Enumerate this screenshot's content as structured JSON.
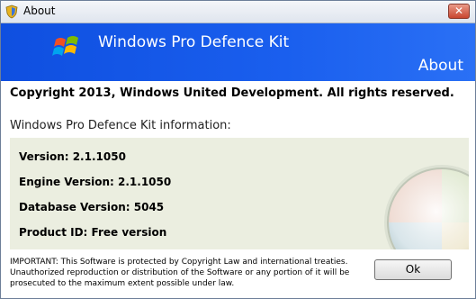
{
  "window": {
    "title": "About"
  },
  "banner": {
    "product_name": "Windows Pro Defence Kit",
    "section_label": "About"
  },
  "copyright": "Copyright 2013, Windows United Development. All rights reserved.",
  "info": {
    "heading": "Windows Pro Defence Kit information:",
    "version": "Version: 2.1.1050",
    "engine_version": "Engine Version: 2.1.1050",
    "database_version": "Database Version: 5045",
    "product_id": "Product ID: Free version"
  },
  "notice": {
    "line1": "IMPORTANT: This Software is protected by Copyright Law and international treaties.",
    "line2": "Unauthorized reproduction or distribution of the Software or any portion of it will be",
    "line3": "prosecuted to the maximum extent possible under law."
  },
  "buttons": {
    "ok_label": "Ok",
    "close_glyph": "✕"
  },
  "colors": {
    "banner": "#1a5fee",
    "panel": "#ebeee0",
    "close_button": "#c8452f"
  },
  "icons": {
    "title": "app-shield-icon",
    "logo": "windows-flag-logo",
    "decoration": "windows-orb-watermark"
  }
}
